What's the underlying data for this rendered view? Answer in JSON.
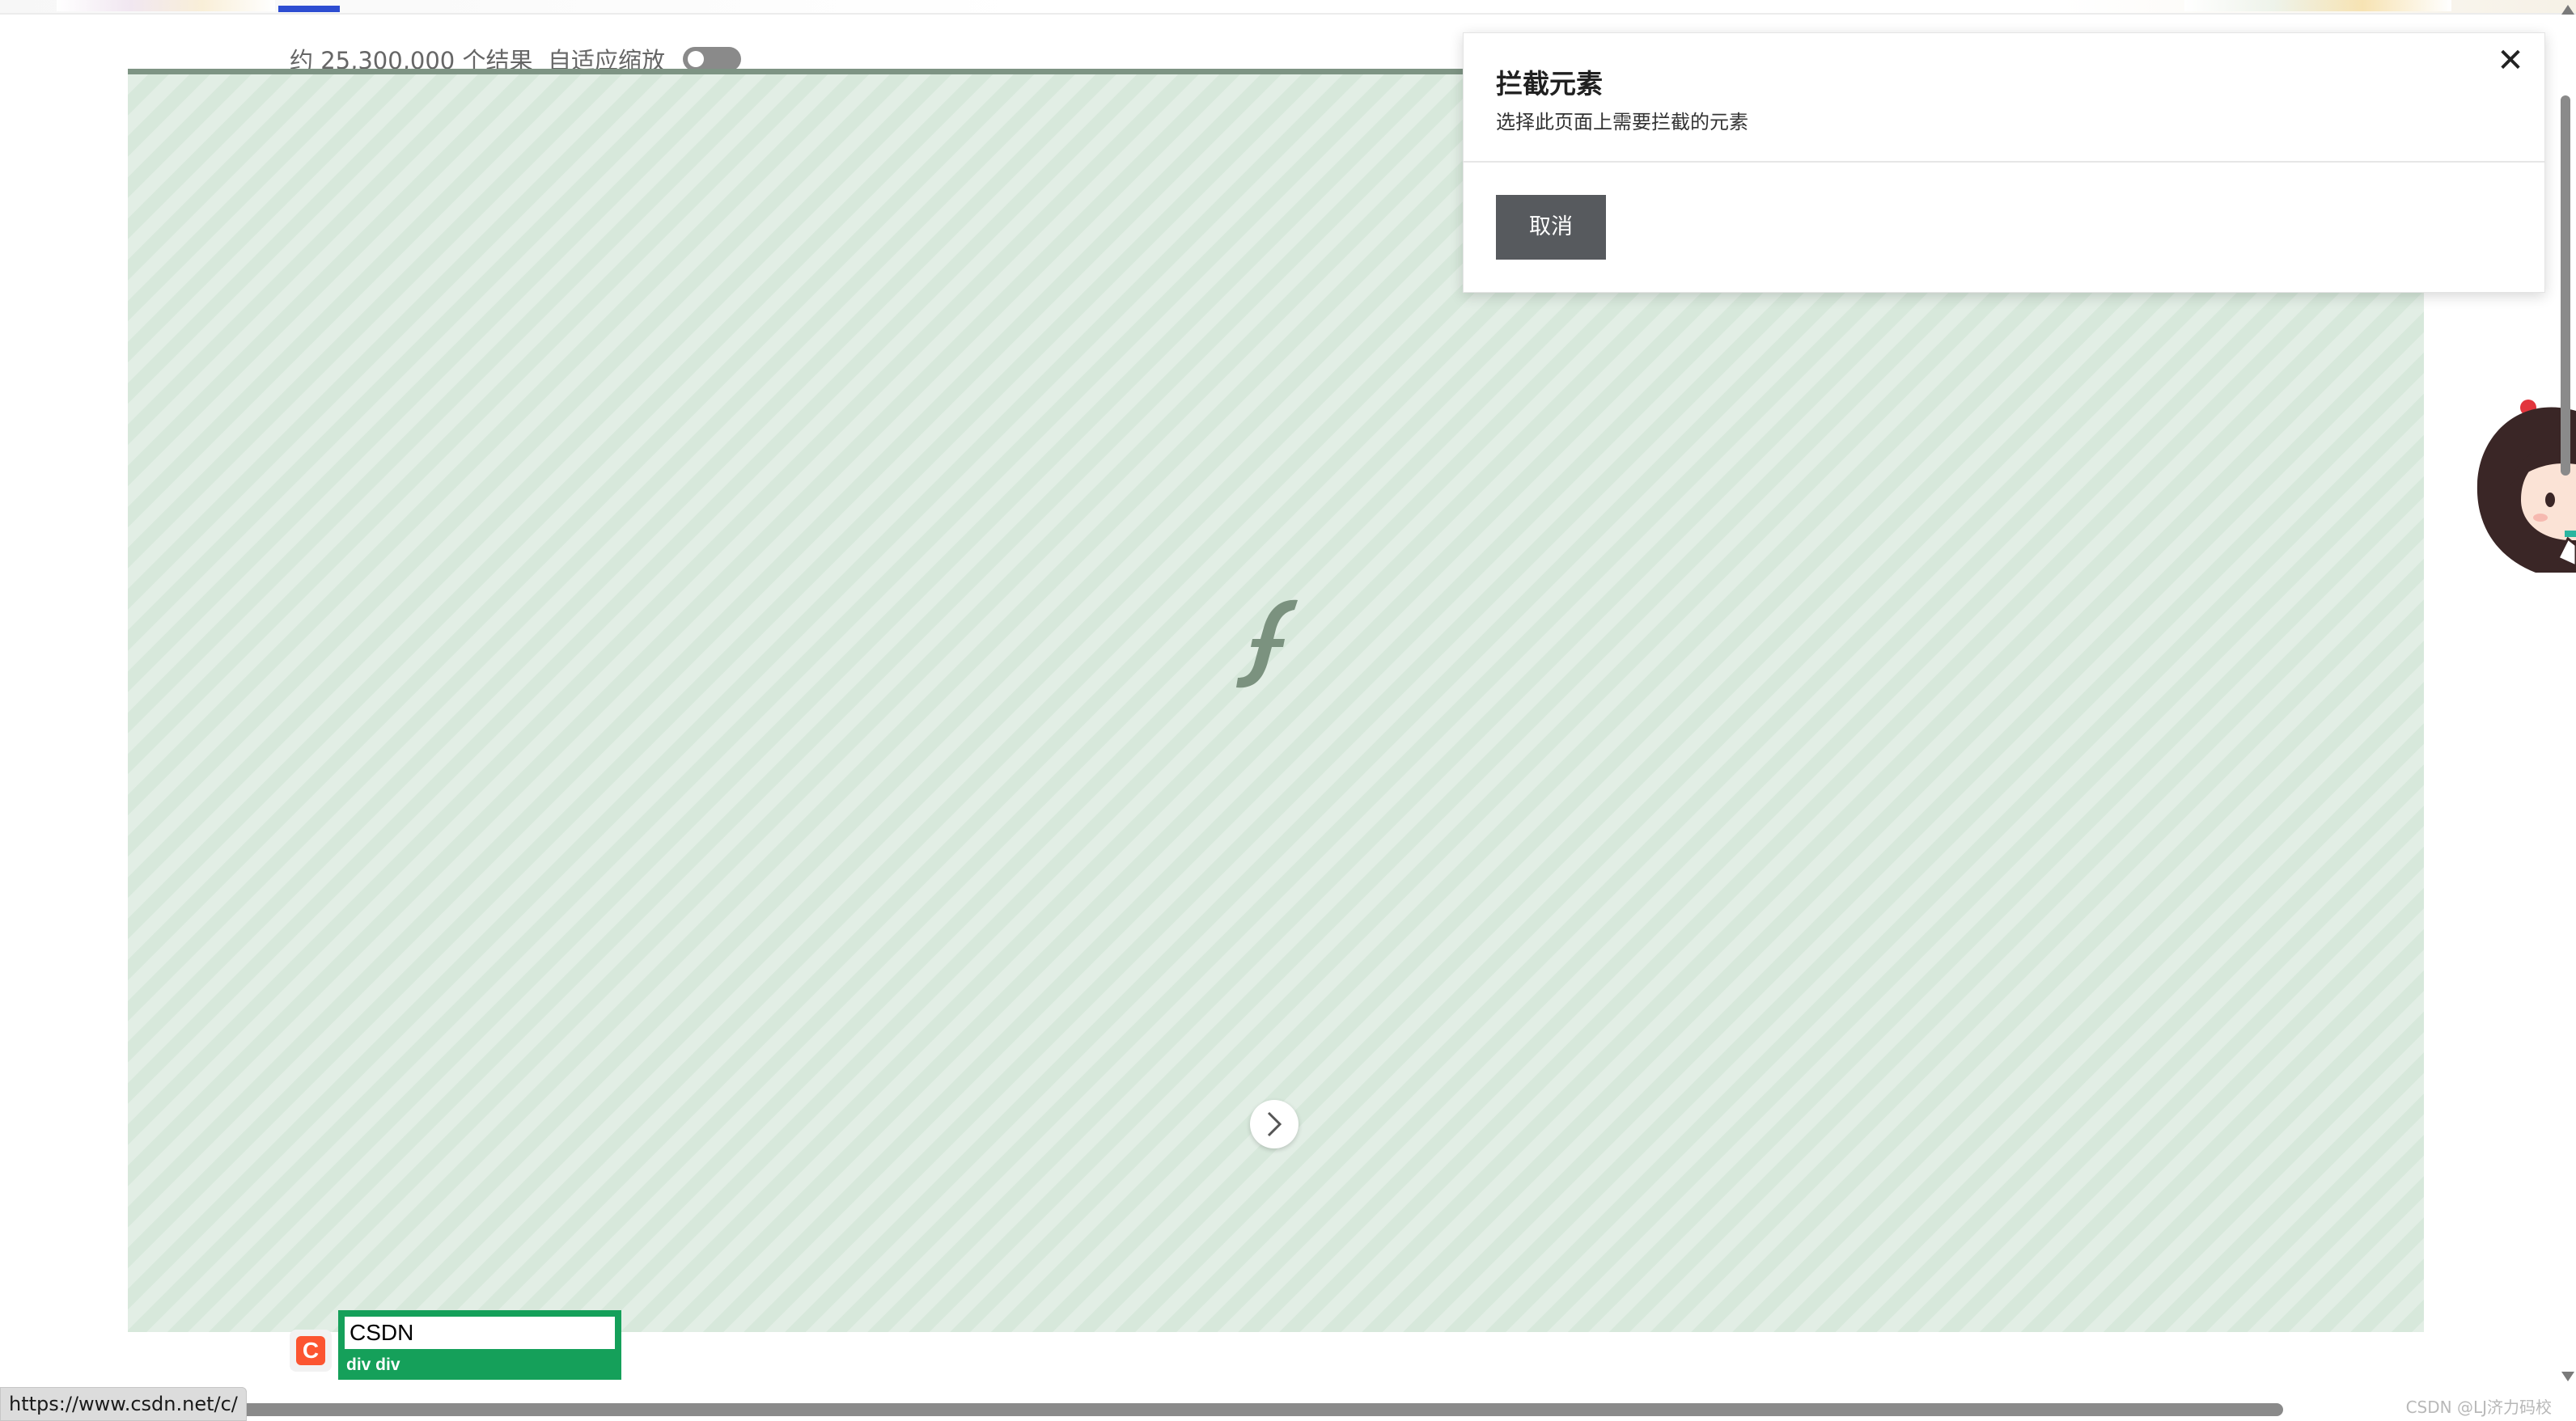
{
  "results": {
    "count_text": "约 25,300,000 个结果"
  },
  "zoom": {
    "label": "自适应缩放",
    "enabled": false
  },
  "dialog": {
    "title": "拦截元素",
    "description": "选择此页面上需要拦截的元素",
    "close_symbol": "✕",
    "cancel_label": "取消"
  },
  "highlight": {
    "text": "CSDN",
    "tag": "div div"
  },
  "logo": {
    "letter": "C"
  },
  "status_bar": {
    "url": "https://www.csdn.net/c/"
  },
  "watermark": "CSDN @LJ济力码校",
  "colors": {
    "accent_blue": "#2d4dd1",
    "flash_bg": "#d7e8db",
    "highlight_green": "#15a05a",
    "csdn_red": "#fc5531",
    "button_gray": "#575a5e"
  }
}
